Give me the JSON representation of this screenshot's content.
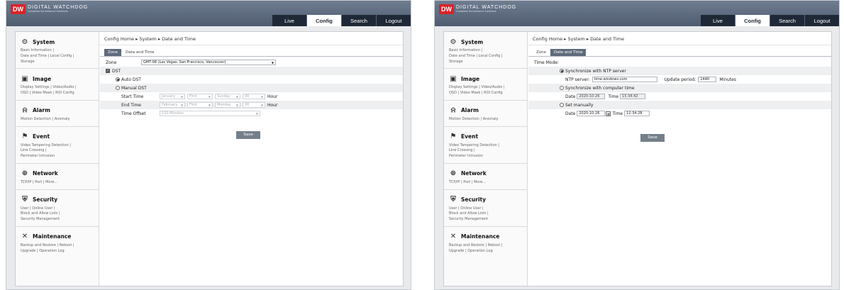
{
  "logo": {
    "badge": "DW",
    "name": "DIGITAL WATCHDOG",
    "tagline": "Complete Surveillance Solutions"
  },
  "nav": {
    "tabs": [
      "Live",
      "Config",
      "Search",
      "Logout"
    ],
    "active": "Config"
  },
  "sidebar": [
    {
      "icon": "gear-icon",
      "glyph": "⚙",
      "title": "System",
      "links": [
        "Basic Information |",
        "Date and Time | Local Config |",
        "Storage"
      ]
    },
    {
      "icon": "image-icon",
      "glyph": "▣",
      "title": "Image",
      "links": [
        "Display Settings | Video/Audio |",
        "OSD | Video Mask | ROI Config"
      ]
    },
    {
      "icon": "alarm-icon",
      "glyph": "⍾",
      "title": "Alarm",
      "links": [
        "Motion Detection | Anomaly"
      ]
    },
    {
      "icon": "event-icon",
      "glyph": "⚑",
      "title": "Event",
      "links": [
        "Video Tampering Detection |",
        "Line Crossing |",
        "Perimeter Intrusion"
      ]
    },
    {
      "icon": "network-icon",
      "glyph": "⊕",
      "title": "Network",
      "links": [
        "TCP/IP | Port | More..."
      ]
    },
    {
      "icon": "security-icon",
      "glyph": "⛨",
      "title": "Security",
      "links": [
        "User | Online User |",
        "Block and Allow Lists |",
        "Security Management"
      ]
    },
    {
      "icon": "maintenance-icon",
      "glyph": "✕",
      "title": "Maintenance",
      "links": [
        "Backup and Restore | Reboot |",
        "Upgrade | Operation Log"
      ]
    }
  ],
  "left": {
    "breadcrumb": "Config Home ▸ System ▸ Date and Time",
    "tabs": [
      "Zone",
      "Data and Time"
    ],
    "active_tab": "Zone",
    "zone_label": "Zone",
    "zone_value": "GMT-08 (Las Vegas, San Francisco, Vancouver)",
    "dst_label": "DST",
    "auto_dst": "Auto DST",
    "manual_dst": "Manual DST",
    "start_time": {
      "label": "Start Time",
      "month": "January",
      "week": "First",
      "day": "Sunday",
      "hour": "00",
      "unit": "Hour"
    },
    "end_time": {
      "label": "End Time",
      "month": "February",
      "week": "First",
      "day": "Monday",
      "hour": "00",
      "unit": "Hour"
    },
    "time_offset": {
      "label": "Time Offset",
      "value": "120 Minutes"
    },
    "save": "Save"
  },
  "right": {
    "breadcrumb": "Config Home ▸ System ▸ Date and Time",
    "tabs": [
      "Zone",
      "Date and Time"
    ],
    "active_tab": "Date and Time",
    "time_mode": "Time Mode:",
    "sync_ntp": "Synchronize with NTP server",
    "ntp_label": "NTP server:",
    "ntp_value": "time.windows.com",
    "period_label": "Update period:",
    "period_value": "1440",
    "period_unit": "Minutes",
    "sync_pc": "Synchronize with computer time",
    "pc_date_label": "Date",
    "pc_date": "2020-10-26",
    "pc_time_label": "Time",
    "pc_time": "15:34:42",
    "manual": "Set manually",
    "man_date_label": "Date",
    "man_date": "2020-10-26",
    "man_time_label": "Time",
    "man_time": "12:34:28",
    "save": "Save"
  }
}
